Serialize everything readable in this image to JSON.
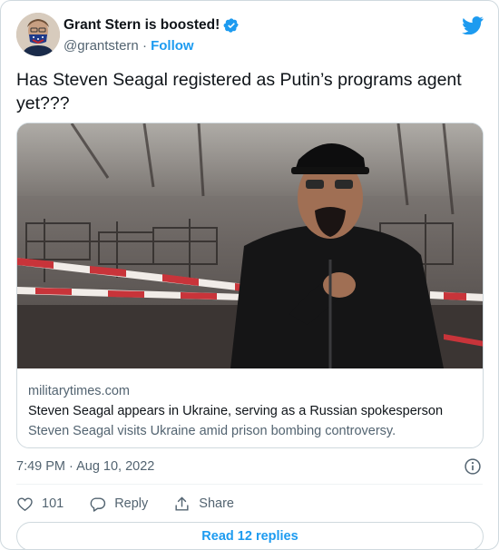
{
  "author": {
    "name": "Grant Stern is boosted!",
    "handle": "@grantstern",
    "separator": "·",
    "follow_label": "Follow",
    "verified": true
  },
  "tweet": {
    "text": "Has Steven Seagal registered as Putin’s programs agent yet???"
  },
  "link_card": {
    "domain": "militarytimes.com",
    "title": "Steven Seagal appears in Ukraine, serving as a Russian spokesperson",
    "description": "Steven Seagal visits Ukraine amid prison bombing controversy."
  },
  "meta": {
    "timestamp": "7:49 PM · Aug 10, 2022"
  },
  "actions": {
    "like_count": "101",
    "reply_label": "Reply",
    "share_label": "Share"
  },
  "footer": {
    "read_replies_label": "Read 12 replies"
  },
  "colors": {
    "accent": "#1d9bf0",
    "text_primary": "#0f1419",
    "text_secondary": "#536471",
    "border": "#cfd9de"
  },
  "icons": {
    "brand": "twitter-bird-icon",
    "verified": "verified-badge-icon",
    "info": "info-icon",
    "like": "heart-icon",
    "reply": "reply-bubble-icon",
    "share": "share-upload-icon"
  }
}
